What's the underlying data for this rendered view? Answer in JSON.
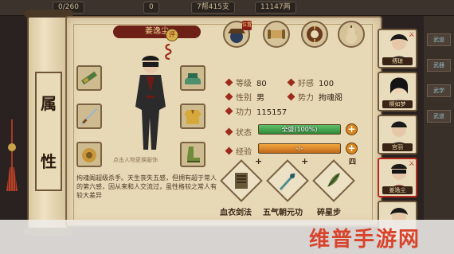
{
  "topbar": {
    "stats": [
      "0/260",
      "0",
      "7帮415支",
      "11147两"
    ]
  },
  "left_scroll": {
    "chars": [
      "属",
      "性"
    ]
  },
  "character": {
    "name": "姜逸尘",
    "rank": "评",
    "figure_caption": "点击人物更换服饰",
    "description": "拘魂阁超级杀手。天生丧失五感，但拥有超于常人的第六感，因从来和人交流过，虽性格较之常人有较大差异"
  },
  "top_icons": [
    {
      "name": "hat",
      "tag": "位置"
    },
    {
      "name": "scroll",
      "tag": ""
    },
    {
      "name": "coin",
      "tag": ""
    },
    {
      "name": "gourd",
      "tag": ""
    }
  ],
  "stats": {
    "level_label": "等级",
    "level": "80",
    "favor_label": "好感",
    "favor": "100",
    "gender_label": "性别",
    "gender": "男",
    "faction_label": "势力",
    "faction": "拘魂阁",
    "power_label": "功力",
    "power": "115157",
    "status_label": "状态",
    "status_text": "全盛(100%)",
    "status_pct": 100,
    "exp_label": "经验",
    "exp_text": "-/-",
    "exp_pct": 100
  },
  "skills": [
    {
      "label": "血衣剑法",
      "mark": "+"
    },
    {
      "label": "五气朝元功",
      "mark": "+"
    },
    {
      "label": "碎星步",
      "mark": "四"
    }
  ],
  "roster": [
    {
      "name": "傅琼",
      "selected": false
    },
    {
      "name": "柳如梦",
      "selected": false
    },
    {
      "name": "宫羽",
      "selected": false
    },
    {
      "name": "姜逸尘",
      "selected": true
    },
    {
      "name": "",
      "selected": false
    }
  ],
  "far_right_tabs": [
    "武道",
    "武器",
    "武学",
    "武道"
  ],
  "watermark": "维普手游网",
  "colors": {
    "accent": "#9b2b1a",
    "status_fill": "#3aa24a",
    "exp_fill": "#d8861e",
    "panel": "#e8d9b6"
  }
}
